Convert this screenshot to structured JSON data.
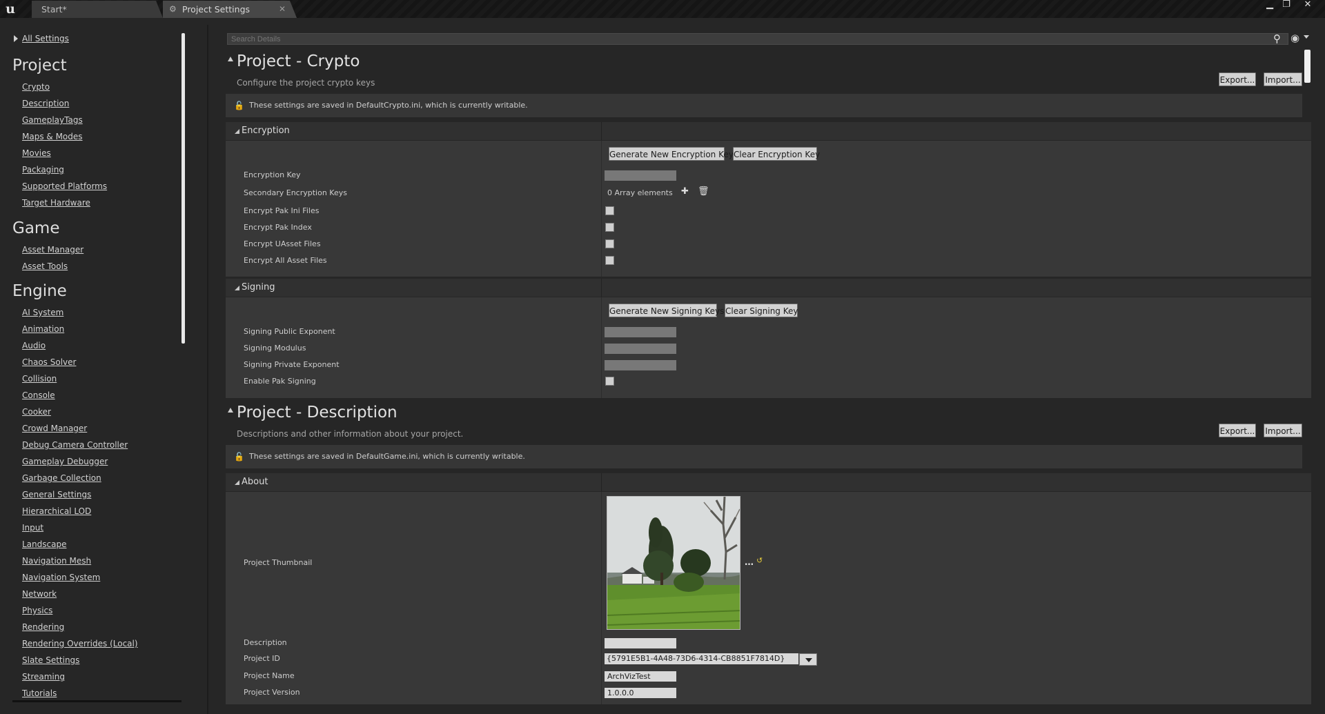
{
  "tabs": [
    {
      "label": "Start*"
    },
    {
      "label": "Project Settings"
    }
  ],
  "sidebar": {
    "all_settings": "All Settings",
    "categories": [
      {
        "title": "Project",
        "items": [
          "Crypto",
          "Description",
          "GameplayTags",
          "Maps & Modes",
          "Movies",
          "Packaging",
          "Supported Platforms",
          "Target Hardware"
        ]
      },
      {
        "title": "Game",
        "items": [
          "Asset Manager",
          "Asset Tools"
        ]
      },
      {
        "title": "Engine",
        "items": [
          "AI System",
          "Animation",
          "Audio",
          "Chaos Solver",
          "Collision",
          "Console",
          "Cooker",
          "Crowd Manager",
          "Debug Camera Controller",
          "Gameplay Debugger",
          "Garbage Collection",
          "General Settings",
          "Hierarchical LOD",
          "Input",
          "Landscape",
          "Navigation Mesh",
          "Navigation System",
          "Network",
          "Physics",
          "Rendering",
          "Rendering Overrides (Local)",
          "Slate Settings",
          "Streaming",
          "Tutorials"
        ]
      }
    ]
  },
  "search": {
    "placeholder": "Search Details"
  },
  "crypto": {
    "title": "Project - Crypto",
    "description": "Configure the project crypto keys",
    "export": "Export...",
    "import": "Import...",
    "notice": "These settings are saved in DefaultCrypto.ini, which is currently writable.",
    "encryption": {
      "header": "Encryption",
      "generate_btn": "Generate New Encryption Key",
      "clear_btn": "Clear Encryption Key",
      "props": {
        "key": "Encryption Key",
        "secondary": "Secondary Encryption Keys",
        "array_elements": "0 Array elements",
        "pak_ini": "Encrypt Pak Ini Files",
        "pak_index": "Encrypt Pak Index",
        "uasset": "Encrypt UAsset Files",
        "all_assets": "Encrypt All Asset Files"
      }
    },
    "signing": {
      "header": "Signing",
      "generate_btn": "Generate New Signing Keys",
      "clear_btn": "Clear Signing Key",
      "props": {
        "public_exp": "Signing Public Exponent",
        "modulus": "Signing Modulus",
        "private_exp": "Signing Private Exponent",
        "enable": "Enable Pak Signing"
      }
    }
  },
  "description": {
    "title": "Project - Description",
    "description": "Descriptions and other information about your project.",
    "export": "Export...",
    "import": "Import...",
    "notice": "These settings are saved in DefaultGame.ini, which is currently writable.",
    "about": {
      "header": "About",
      "thumbnail_label": "Project Thumbnail",
      "description_label": "Description",
      "project_id_label": "Project ID",
      "project_id": "{5791E5B1-4A48-73D6-4314-CB8851F7814D}",
      "project_name_label": "Project Name",
      "project_name": "ArchVizTest",
      "project_version_label": "Project Version",
      "project_version": "1.0.0.0"
    }
  }
}
